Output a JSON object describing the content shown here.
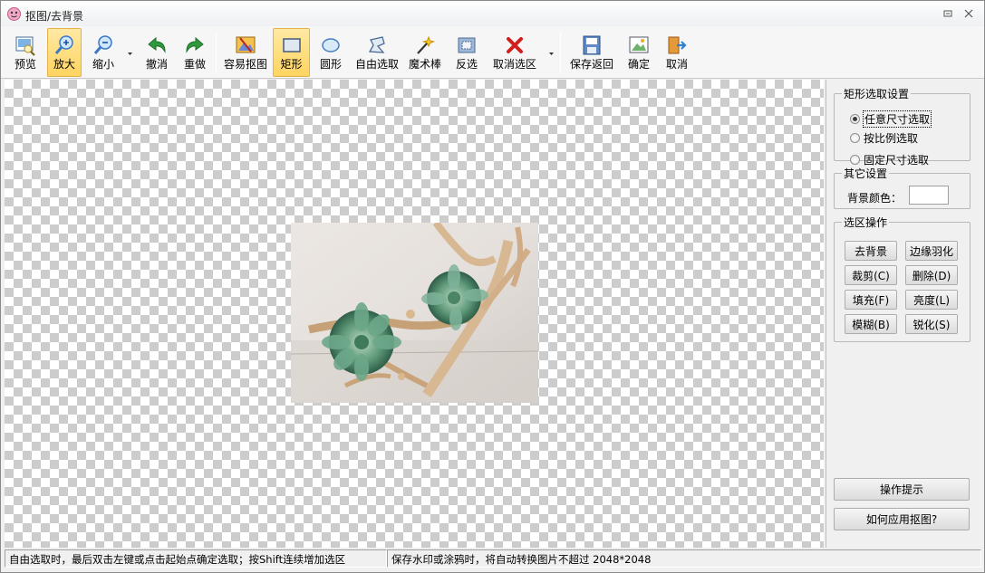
{
  "window": {
    "title": "抠图/去背景"
  },
  "toolbar": {
    "preview": "预览",
    "zoom_in": "放大",
    "zoom_out": "缩小",
    "undo": "撤消",
    "redo": "重做",
    "easy_cutout": "容易抠图",
    "rectangle": "矩形",
    "ellipse": "圆形",
    "free_select": "自由选取",
    "magic_wand": "魔术棒",
    "invert": "反选",
    "cancel_selection": "取消选区",
    "save_return": "保存返回",
    "confirm": "确定",
    "cancel": "取消"
  },
  "rect_settings": {
    "legend": "矩形选取设置",
    "any_size": "任意尺寸选取",
    "by_ratio": "按比例选取",
    "fixed_size": "固定尺寸选取",
    "selected": "any_size"
  },
  "other_settings": {
    "legend": "其它设置",
    "bg_color_label": "背景颜色：",
    "bg_color": "#ffffff"
  },
  "selection_ops": {
    "legend": "选区操作",
    "remove_bg": "去背景",
    "feather": "边缘羽化",
    "crop": "裁剪(C)",
    "delete": "删除(D)",
    "fill": "填充(F)",
    "brightness": "亮度(L)",
    "blur": "模糊(B)",
    "sharpen": "锐化(S)"
  },
  "help": {
    "tips": "操作提示",
    "how_to": "如何应用抠图?"
  },
  "status": {
    "left": "自由选取时，最后双击左键或点击起始点确定选取；按Shift连续增加选区",
    "right": "保存水印或涂鸦时，将自动转换图片不超过 2048*2048"
  },
  "colors": {
    "accent": "#ffd460",
    "checker": "#cccccc"
  }
}
